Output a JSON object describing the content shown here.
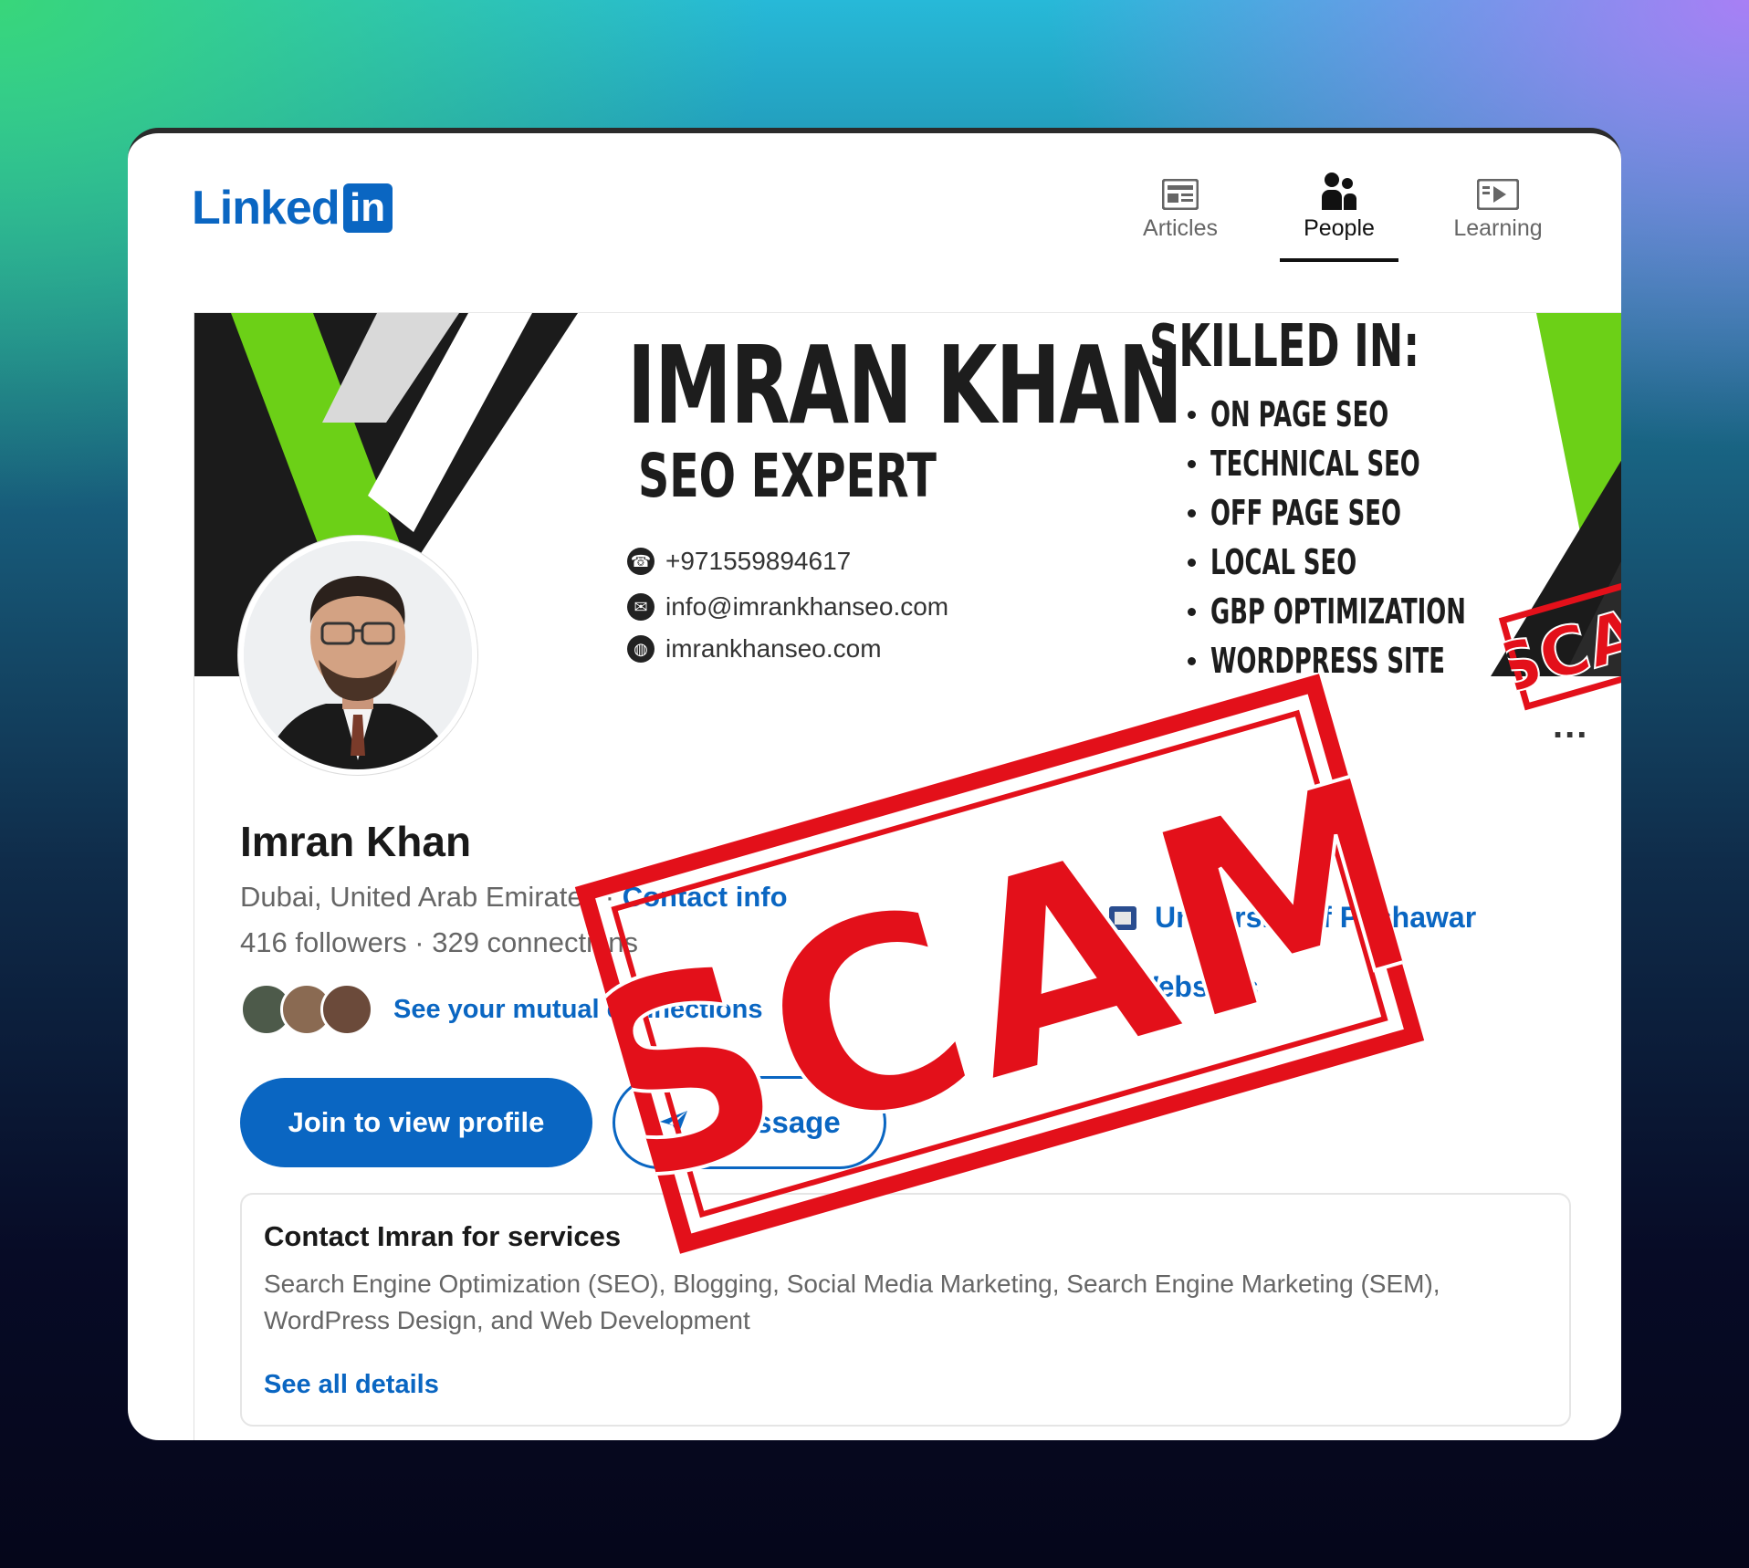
{
  "header": {
    "logo_text": "Linked",
    "logo_box": "in",
    "nav": [
      {
        "label": "Articles",
        "icon": "articles-icon"
      },
      {
        "label": "People",
        "icon": "people-icon",
        "active": true
      },
      {
        "label": "Learning",
        "icon": "learning-icon"
      }
    ]
  },
  "banner": {
    "name": "IMRAN KHAN",
    "title": "SEO EXPERT",
    "phone": "+971559894617",
    "email": "info@imrankhanseo.com",
    "website": "imrankhanseo.com",
    "skilled_title": "SKILLED IN:",
    "skills": [
      "ON PAGE SEO",
      "TECHNICAL SEO",
      "OFF PAGE SEO",
      "LOCAL SEO",
      "GBP OPTIMIZATION",
      "WORDPRESS SITE"
    ],
    "accent_color": "#6cd017"
  },
  "profile": {
    "name": "Imran Khan",
    "location": "Dubai, United Arab Emirates",
    "contact_info": "Contact info",
    "followers": "416 followers",
    "connections": "329 connections",
    "mutual_link": "See your mutual connections",
    "education": "University of Peshawar",
    "websites": "Websites",
    "more": "..."
  },
  "actions": {
    "join": "Join to view profile",
    "message": "Message"
  },
  "services": {
    "heading": "Contact Imran for services",
    "list": "Search Engine Optimization (SEO), Blogging, Social Media Marketing, Search Engine Marketing (SEM), WordPress Design, and Web Development",
    "link": "See all details"
  },
  "stamps": {
    "big": "SCAM",
    "small": "SCAM",
    "color": "#e3101a"
  }
}
